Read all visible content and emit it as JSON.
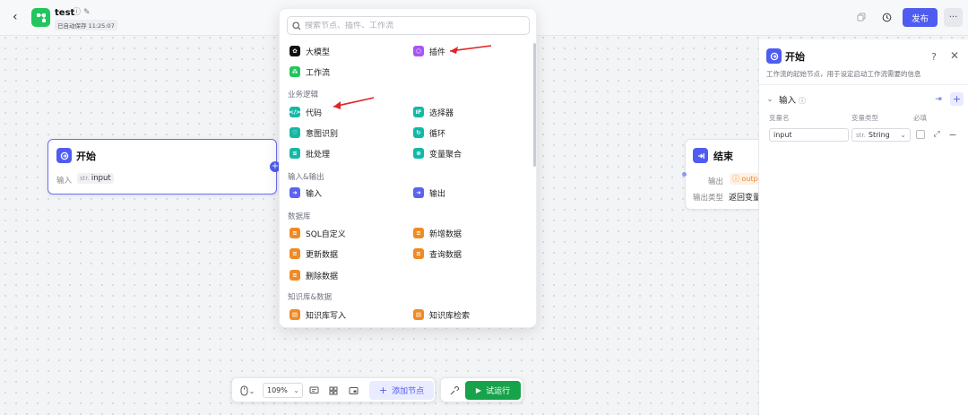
{
  "header": {
    "app_name": "test",
    "save_status": "已自动保存 11:25:07",
    "publish_label": "发布",
    "more_label": "···"
  },
  "start_node": {
    "title": "开始",
    "input_label": "输入",
    "var_type": "str.",
    "var_name": "input"
  },
  "end_node": {
    "title": "结束",
    "output_label": "输出",
    "output_chip": "outp",
    "output_type_label": "输出类型",
    "output_type_value": "返回变量"
  },
  "node_picker": {
    "search_placeholder": "搜索节点、插件、工作流",
    "groups": [
      {
        "label": "",
        "items": [
          "大模型",
          "插件",
          "工作流"
        ]
      },
      {
        "label": "业务逻辑",
        "items": [
          "代码",
          "选择器",
          "意图识别",
          "循环",
          "批处理",
          "变量聚合"
        ]
      },
      {
        "label": "输入&输出",
        "items": [
          "输入",
          "输出"
        ]
      },
      {
        "label": "数据库",
        "items": [
          "SQL自定义",
          "新增数据",
          "更新数据",
          "查询数据",
          "删除数据"
        ]
      },
      {
        "label": "知识库&数据",
        "items": [
          "知识库写入",
          "知识库检索"
        ]
      }
    ],
    "icons": {
      "大模型": "llm-icon",
      "插件": "plugin-icon",
      "工作流": "workflow-icon",
      "代码": "code-icon",
      "选择器": "selector-icon",
      "意图识别": "intent-icon",
      "循环": "loop-icon",
      "批处理": "batch-icon",
      "变量聚合": "variable-merge-icon",
      "输入": "input-icon",
      "输出": "output-icon"
    },
    "icon_glyphs": {
      "选择器": "IF"
    }
  },
  "properties_panel": {
    "title": "开始",
    "description": "工作流的起始节点，用于设定启动工作流需要的信息",
    "input_section": "输入",
    "col_var_name": "变量名",
    "col_var_type": "变量类型",
    "col_required": "必填",
    "row_var_name": "input",
    "row_var_type_prefix": "str.",
    "row_var_type": "String"
  },
  "toolbar": {
    "zoom": "109%",
    "add_node_label": "添加节点",
    "test_run_label": "试运行"
  },
  "colors": {
    "accent": "#4f5cf0",
    "run_green": "#16a34a",
    "annotation_arrow": "#e02424"
  }
}
